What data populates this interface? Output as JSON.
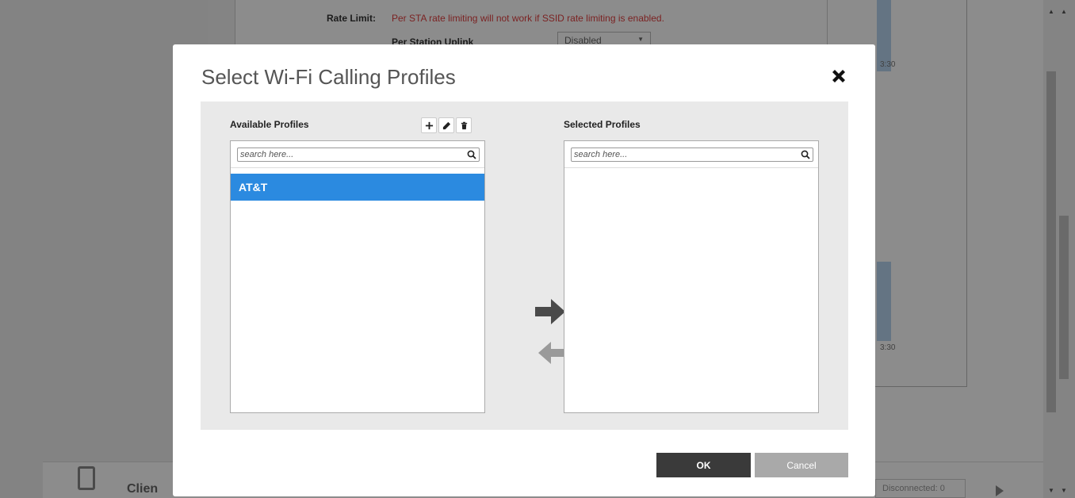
{
  "background": {
    "rate_limit_label": "Rate Limit:",
    "rate_limit_warning": "Per STA rate limiting will not work if SSID rate limiting is enabled.",
    "per_station_uplink_label": "Per Station Uplink",
    "per_station_uplink_value": "Disabled",
    "chart_time_1": "3:30",
    "chart_time_2": "3:30",
    "clients_label": "Clien",
    "disconnected_label": "Disconnected: 0"
  },
  "modal": {
    "title": "Select Wi-Fi Calling Profiles",
    "available": {
      "heading": "Available Profiles",
      "search_placeholder": "search here...",
      "items": [
        {
          "label": "AT&T",
          "selected": true
        }
      ]
    },
    "selected": {
      "heading": "Selected Profiles",
      "search_placeholder": "search here...",
      "items": []
    },
    "ok_label": "OK",
    "cancel_label": "Cancel"
  },
  "colors": {
    "accent": "#2b8ae0",
    "warning": "#e04040",
    "primary_button": "#3a3a3a",
    "secondary_button": "#a9a9a9"
  },
  "icons": {
    "close": "close-icon",
    "add": "plus-icon",
    "edit": "pencil-icon",
    "delete": "trash-icon",
    "search": "search-icon",
    "move_right": "arrow-right-icon",
    "move_left": "arrow-left-icon"
  }
}
